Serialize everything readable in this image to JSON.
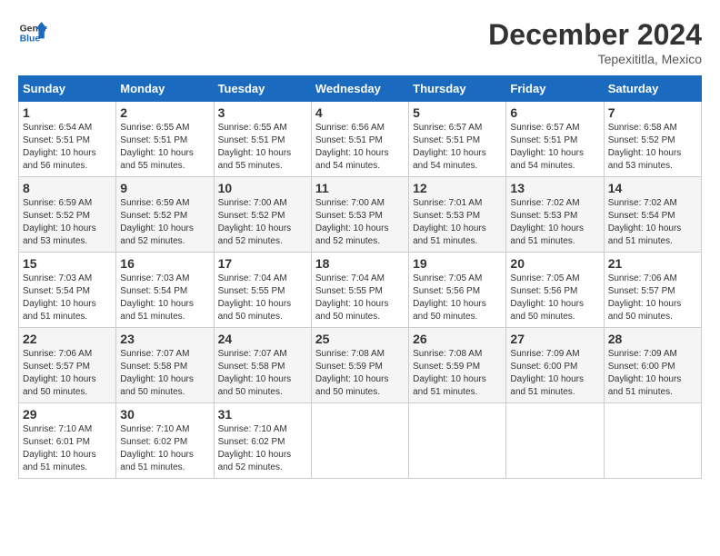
{
  "header": {
    "logo_line1": "General",
    "logo_line2": "Blue",
    "month": "December 2024",
    "location": "Tepexititla, Mexico"
  },
  "weekdays": [
    "Sunday",
    "Monday",
    "Tuesday",
    "Wednesday",
    "Thursday",
    "Friday",
    "Saturday"
  ],
  "weeks": [
    [
      {
        "day": "1",
        "sunrise": "6:54 AM",
        "sunset": "5:51 PM",
        "daylight": "10 hours and 56 minutes."
      },
      {
        "day": "2",
        "sunrise": "6:55 AM",
        "sunset": "5:51 PM",
        "daylight": "10 hours and 55 minutes."
      },
      {
        "day": "3",
        "sunrise": "6:55 AM",
        "sunset": "5:51 PM",
        "daylight": "10 hours and 55 minutes."
      },
      {
        "day": "4",
        "sunrise": "6:56 AM",
        "sunset": "5:51 PM",
        "daylight": "10 hours and 54 minutes."
      },
      {
        "day": "5",
        "sunrise": "6:57 AM",
        "sunset": "5:51 PM",
        "daylight": "10 hours and 54 minutes."
      },
      {
        "day": "6",
        "sunrise": "6:57 AM",
        "sunset": "5:51 PM",
        "daylight": "10 hours and 54 minutes."
      },
      {
        "day": "7",
        "sunrise": "6:58 AM",
        "sunset": "5:52 PM",
        "daylight": "10 hours and 53 minutes."
      }
    ],
    [
      {
        "day": "8",
        "sunrise": "6:59 AM",
        "sunset": "5:52 PM",
        "daylight": "10 hours and 53 minutes."
      },
      {
        "day": "9",
        "sunrise": "6:59 AM",
        "sunset": "5:52 PM",
        "daylight": "10 hours and 52 minutes."
      },
      {
        "day": "10",
        "sunrise": "7:00 AM",
        "sunset": "5:52 PM",
        "daylight": "10 hours and 52 minutes."
      },
      {
        "day": "11",
        "sunrise": "7:00 AM",
        "sunset": "5:53 PM",
        "daylight": "10 hours and 52 minutes."
      },
      {
        "day": "12",
        "sunrise": "7:01 AM",
        "sunset": "5:53 PM",
        "daylight": "10 hours and 51 minutes."
      },
      {
        "day": "13",
        "sunrise": "7:02 AM",
        "sunset": "5:53 PM",
        "daylight": "10 hours and 51 minutes."
      },
      {
        "day": "14",
        "sunrise": "7:02 AM",
        "sunset": "5:54 PM",
        "daylight": "10 hours and 51 minutes."
      }
    ],
    [
      {
        "day": "15",
        "sunrise": "7:03 AM",
        "sunset": "5:54 PM",
        "daylight": "10 hours and 51 minutes."
      },
      {
        "day": "16",
        "sunrise": "7:03 AM",
        "sunset": "5:54 PM",
        "daylight": "10 hours and 51 minutes."
      },
      {
        "day": "17",
        "sunrise": "7:04 AM",
        "sunset": "5:55 PM",
        "daylight": "10 hours and 50 minutes."
      },
      {
        "day": "18",
        "sunrise": "7:04 AM",
        "sunset": "5:55 PM",
        "daylight": "10 hours and 50 minutes."
      },
      {
        "day": "19",
        "sunrise": "7:05 AM",
        "sunset": "5:56 PM",
        "daylight": "10 hours and 50 minutes."
      },
      {
        "day": "20",
        "sunrise": "7:05 AM",
        "sunset": "5:56 PM",
        "daylight": "10 hours and 50 minutes."
      },
      {
        "day": "21",
        "sunrise": "7:06 AM",
        "sunset": "5:57 PM",
        "daylight": "10 hours and 50 minutes."
      }
    ],
    [
      {
        "day": "22",
        "sunrise": "7:06 AM",
        "sunset": "5:57 PM",
        "daylight": "10 hours and 50 minutes."
      },
      {
        "day": "23",
        "sunrise": "7:07 AM",
        "sunset": "5:58 PM",
        "daylight": "10 hours and 50 minutes."
      },
      {
        "day": "24",
        "sunrise": "7:07 AM",
        "sunset": "5:58 PM",
        "daylight": "10 hours and 50 minutes."
      },
      {
        "day": "25",
        "sunrise": "7:08 AM",
        "sunset": "5:59 PM",
        "daylight": "10 hours and 50 minutes."
      },
      {
        "day": "26",
        "sunrise": "7:08 AM",
        "sunset": "5:59 PM",
        "daylight": "10 hours and 51 minutes."
      },
      {
        "day": "27",
        "sunrise": "7:09 AM",
        "sunset": "6:00 PM",
        "daylight": "10 hours and 51 minutes."
      },
      {
        "day": "28",
        "sunrise": "7:09 AM",
        "sunset": "6:00 PM",
        "daylight": "10 hours and 51 minutes."
      }
    ],
    [
      {
        "day": "29",
        "sunrise": "7:10 AM",
        "sunset": "6:01 PM",
        "daylight": "10 hours and 51 minutes."
      },
      {
        "day": "30",
        "sunrise": "7:10 AM",
        "sunset": "6:02 PM",
        "daylight": "10 hours and 51 minutes."
      },
      {
        "day": "31",
        "sunrise": "7:10 AM",
        "sunset": "6:02 PM",
        "daylight": "10 hours and 52 minutes."
      },
      null,
      null,
      null,
      null
    ]
  ]
}
